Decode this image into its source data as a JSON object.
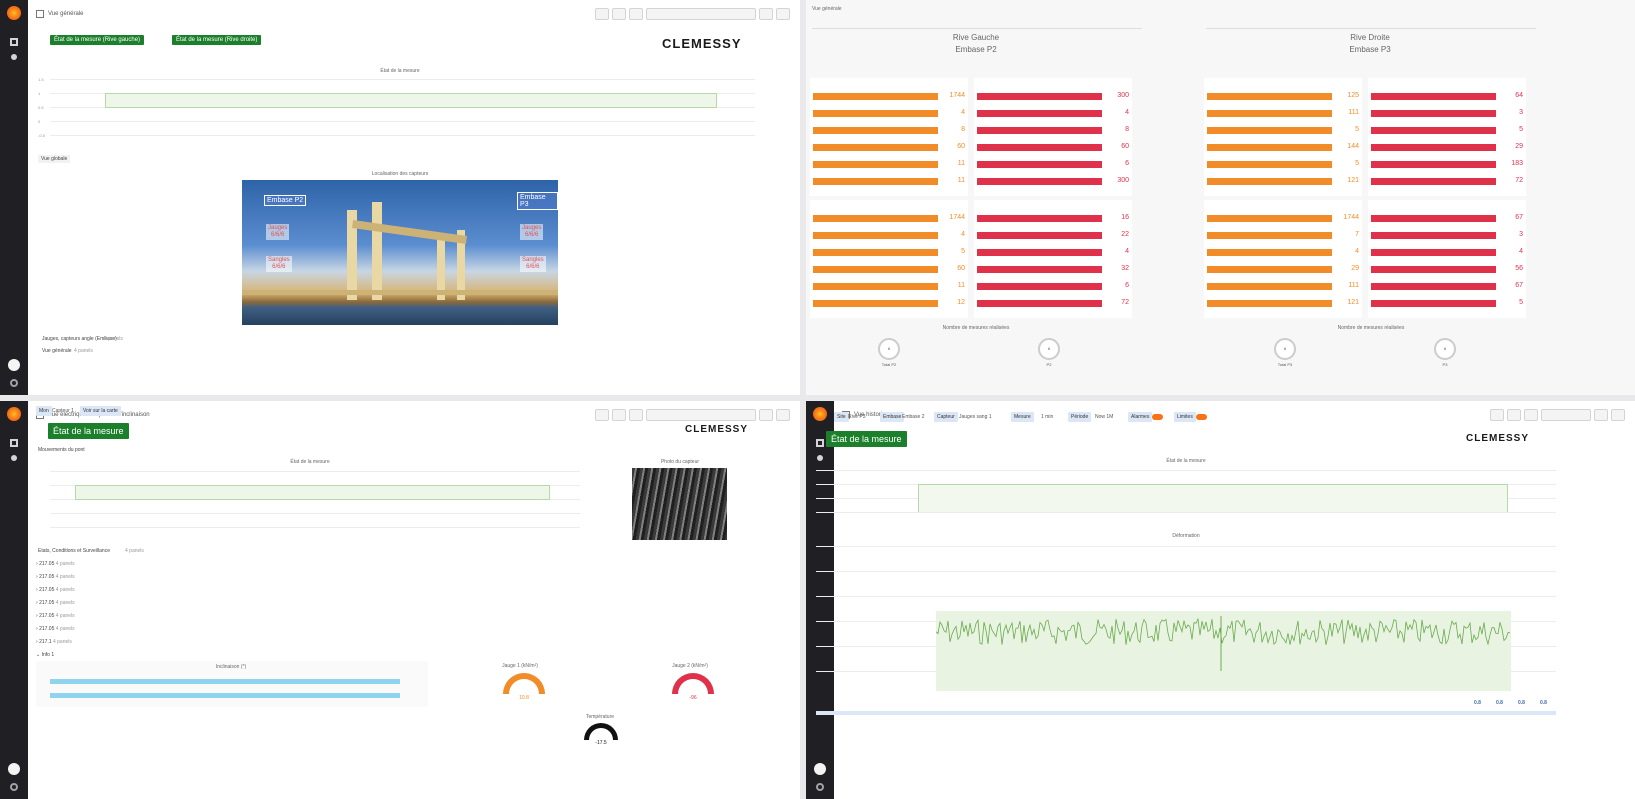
{
  "q1": {
    "breadcrumb": "Vue générale",
    "btn_left": "État de la mesure (Rive gauche)",
    "btn_right": "État de la mesure (Rive droite)",
    "brand": "CLEMESSY",
    "state_chart_title": "État de la mesure",
    "row_title": "Vue globale",
    "bridge_panel_title": "Localisation des capteurs",
    "overlay_p2": "Embase P2",
    "overlay_p3": "Embase P3",
    "overlay_left_1": "Jauges\n6/6/6",
    "overlay_left_2": "Sangles\n6/6/6",
    "overlay_right_1": "Jauges\n6/6/6",
    "overlay_right_2": "Sangles\n6/6/6",
    "footer_1": "Jauges, capteurs angle (Embase)",
    "footer_1_badge": "4 panels",
    "footer_2": "Vue générale",
    "footer_2_badge": "4 panels",
    "ylabels": [
      "1.5",
      "1",
      "0.5",
      "0",
      "-0.5"
    ]
  },
  "q2": {
    "breadcrumb": "Vue générale",
    "left_site": "Rive Gauche\nEmbase P2",
    "right_site": "Rive Droite\nEmbase P3",
    "gauge_titles_left": "Nombre de mesures réalisées",
    "gauge_titles_right": "Nombre de mesures réalisées",
    "gauges": [
      {
        "label": "Total P2",
        "value": "6"
      },
      {
        "label": "P2",
        "value": "6"
      },
      {
        "label": "Total P3",
        "value": "6"
      },
      {
        "label": "P3",
        "value": "6"
      }
    ],
    "panels": {
      "tl_orange": [
        "1744",
        "4",
        "8",
        "60",
        "11",
        "11"
      ],
      "tl_red": [
        "300",
        "4",
        "8",
        "60",
        "6",
        "300"
      ],
      "bl_orange": [
        "1744",
        "4",
        "5",
        "60",
        "11",
        "12"
      ],
      "bl_red": [
        "16",
        "22",
        "4",
        "32",
        "6",
        "72"
      ],
      "tr_orange": [
        "125",
        "111",
        "5",
        "144",
        "5",
        "121"
      ],
      "tr_red": [
        "64",
        "3",
        "5",
        "29",
        "183",
        "72"
      ],
      "br_orange": [
        "1744",
        "7",
        "4",
        "29",
        "111",
        "121"
      ],
      "br_red": [
        "67",
        "3",
        "4",
        "56",
        "67",
        "5"
      ]
    }
  },
  "q3": {
    "breadcrumb": "Vue électrique / Capteurs d'inclinaison",
    "tab_1": "Mon",
    "tab_2": "Capteur 1",
    "tab_3": "Voir sur la carte",
    "btn_state": "État de la mesure",
    "brand": "CLEMESSY",
    "row_title": "Mouvements du pont",
    "chart_title": "État de la mesure",
    "photo_title": "Photo du capteur",
    "row2_title": "Etats, Conditions et Surveillance",
    "row2_badge": "4 panels",
    "list_rows": [
      "217.05",
      "217.05",
      "217.05",
      "217.05",
      "217.05",
      "217.05",
      "217.1"
    ],
    "list_badge": "4 panels",
    "row3_title": "Info 1",
    "bar_panel_title": "Inclinaison (°)",
    "gauge_1_title": "Jauge 1 (kN/m²)",
    "gauge_1_value": "10.8",
    "gauge_2_title": "Jauge 2 (kN/m²)",
    "gauge_2_value": "-96",
    "gauge_3_title": "Température",
    "gauge_3_value": "-17.5"
  },
  "q4": {
    "breadcrumb": "Vue historique",
    "vars": [
      {
        "name": "Site",
        "value": "Rive P3"
      },
      {
        "name": "Embase",
        "value": "Embase 2"
      },
      {
        "name": "Capteur",
        "value": "Jauges sang 1"
      },
      {
        "name": "Mesure",
        "value": "1 min"
      },
      {
        "name": "Période",
        "value": "Now 1M"
      },
      {
        "name": "Alarmes",
        "value": ""
      },
      {
        "name": "Limites",
        "value": ""
      }
    ],
    "btn_state": "État de la mesure",
    "brand": "CLEMESSY",
    "state_title": "État de la mesure",
    "chart_title": "Déformation",
    "legend": [
      "0.8",
      "0.8",
      "0.8",
      "0.8"
    ]
  }
}
